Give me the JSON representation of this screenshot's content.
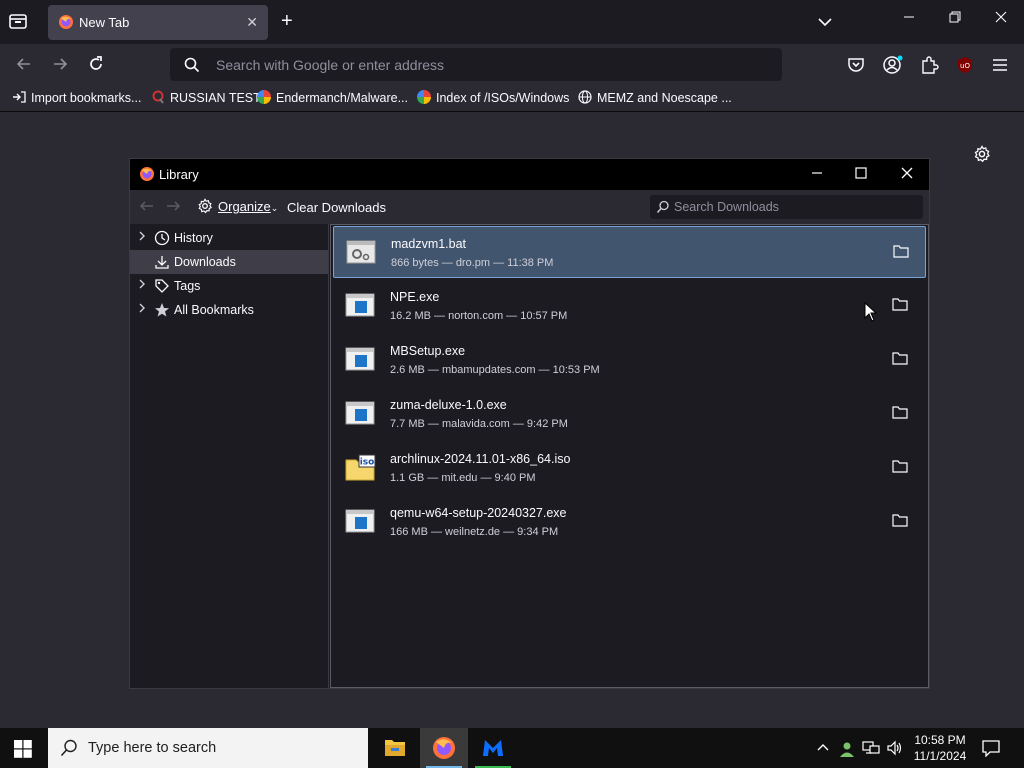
{
  "browser": {
    "tab": {
      "title": "New Tab"
    },
    "urlbar": {
      "placeholder": "Search with Google or enter address"
    },
    "bookmarks": [
      {
        "label": "Import bookmarks...",
        "icon": "import-icon"
      },
      {
        "label": "RUSSIAN TEST",
        "icon": "magnifier-icon"
      },
      {
        "label": "Endermanch/Malware...",
        "icon": "google-icon"
      },
      {
        "label": "Index of /ISOs/Windows",
        "icon": "google-icon"
      },
      {
        "label": "MEMZ and Noescape ...",
        "icon": "globe-icon"
      }
    ]
  },
  "library": {
    "title": "Library",
    "toolbar": {
      "organize": "Organize",
      "clear": "Clear Downloads",
      "search_placeholder": "Search Downloads"
    },
    "sidebar": [
      {
        "label": "History",
        "icon": "clock-icon",
        "expandable": true
      },
      {
        "label": "Downloads",
        "icon": "download-icon",
        "expandable": false,
        "selected": true
      },
      {
        "label": "Tags",
        "icon": "tag-icon",
        "expandable": true
      },
      {
        "label": "All Bookmarks",
        "icon": "star-icon",
        "expandable": true
      }
    ],
    "downloads": [
      {
        "name": "madzvm1.bat",
        "status": "866 bytes — dro.pm — 11:38 PM",
        "type": "bat",
        "selected": true
      },
      {
        "name": "NPE.exe",
        "status": "16.2 MB — norton.com — 10:57 PM",
        "type": "exe"
      },
      {
        "name": "MBSetup.exe",
        "status": "2.6 MB — mbamupdates.com — 10:53 PM",
        "type": "exe"
      },
      {
        "name": "zuma-deluxe-1.0.exe",
        "status": "7.7 MB — malavida.com — 9:42 PM",
        "type": "exe"
      },
      {
        "name": "archlinux-2024.11.01-x86_64.iso",
        "status": "1.1 GB — mit.edu — 9:40 PM",
        "type": "iso"
      },
      {
        "name": "qemu-w64-setup-20240327.exe",
        "status": "166 MB — weilnetz.de — 9:34 PM",
        "type": "exe"
      }
    ]
  },
  "taskbar": {
    "search_placeholder": "Type here to search",
    "time": "10:58 PM",
    "date": "11/1/2024"
  },
  "colors": {
    "accent": "#76b9ed",
    "selection": "#42556e",
    "chrome_dark": "#1c1b22",
    "chrome": "#2b2a33"
  }
}
